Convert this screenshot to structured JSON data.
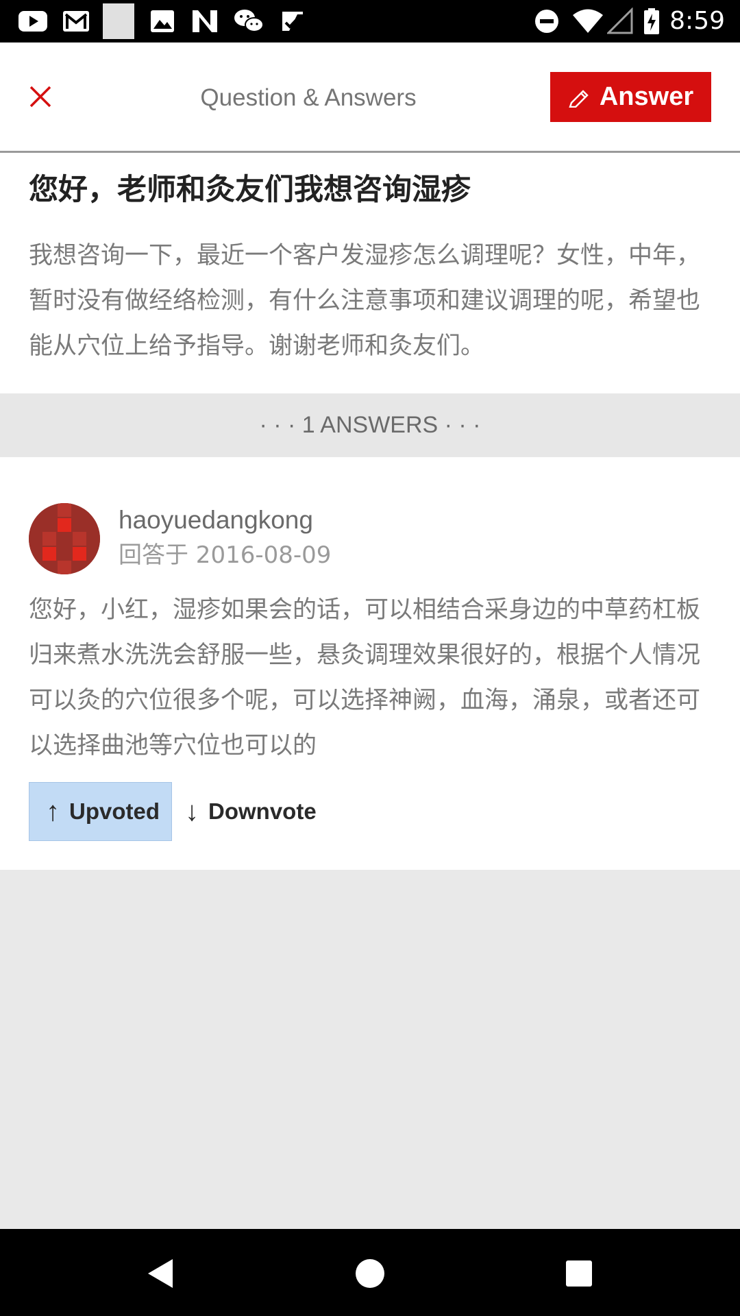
{
  "status_bar": {
    "time": "8:59",
    "left_icons": [
      "youtube-icon",
      "gmail-icon",
      "blank-notification-icon",
      "image-icon",
      "n-app-icon",
      "wechat-icon",
      "checkmark-app-icon"
    ],
    "right_icons": [
      "do-not-disturb-icon",
      "wifi-icon",
      "cellular-signal-icon",
      "battery-charging-icon"
    ]
  },
  "header": {
    "title": "Question & Answers",
    "answer_button_label": "Answer",
    "close_icon": "close-icon",
    "answer_icon": "pencil-icon"
  },
  "question": {
    "title": "您好，老师和灸友们我想咨询湿疹",
    "body": "我想咨询一下，最近一个客户发湿疹怎么调理呢？女性，中年，暂时没有做经络检测，有什么注意事项和建议调理的呢，希望也能从穴位上给予指导。谢谢老师和灸友们。"
  },
  "answers_count_label": "· · · 1 ANSWERS · · ·",
  "answers": [
    {
      "author": "haoyuedangkong",
      "date": "回答于 2016-08-09",
      "body": "您好，小红，湿疹如果会的话，可以相结合采身边的中草药杠板归来煮水洗洗会舒服一些，悬灸调理效果很好的，根据个人情况可以灸的穴位很多个呢，可以选择神阙，血海，涌泉，或者还可以选择曲池等穴位也可以的",
      "upvote_label": "Upvoted",
      "downvote_label": "Downvote"
    }
  ],
  "nav_bar": {
    "back_icon": "back-triangle-icon",
    "home_icon": "home-circle-icon",
    "recents_icon": "recents-square-icon"
  },
  "colors": {
    "brand_red": "#d50f0f",
    "upvoted_bg": "#c2dbf5",
    "page_bg": "#e9e9e9"
  }
}
